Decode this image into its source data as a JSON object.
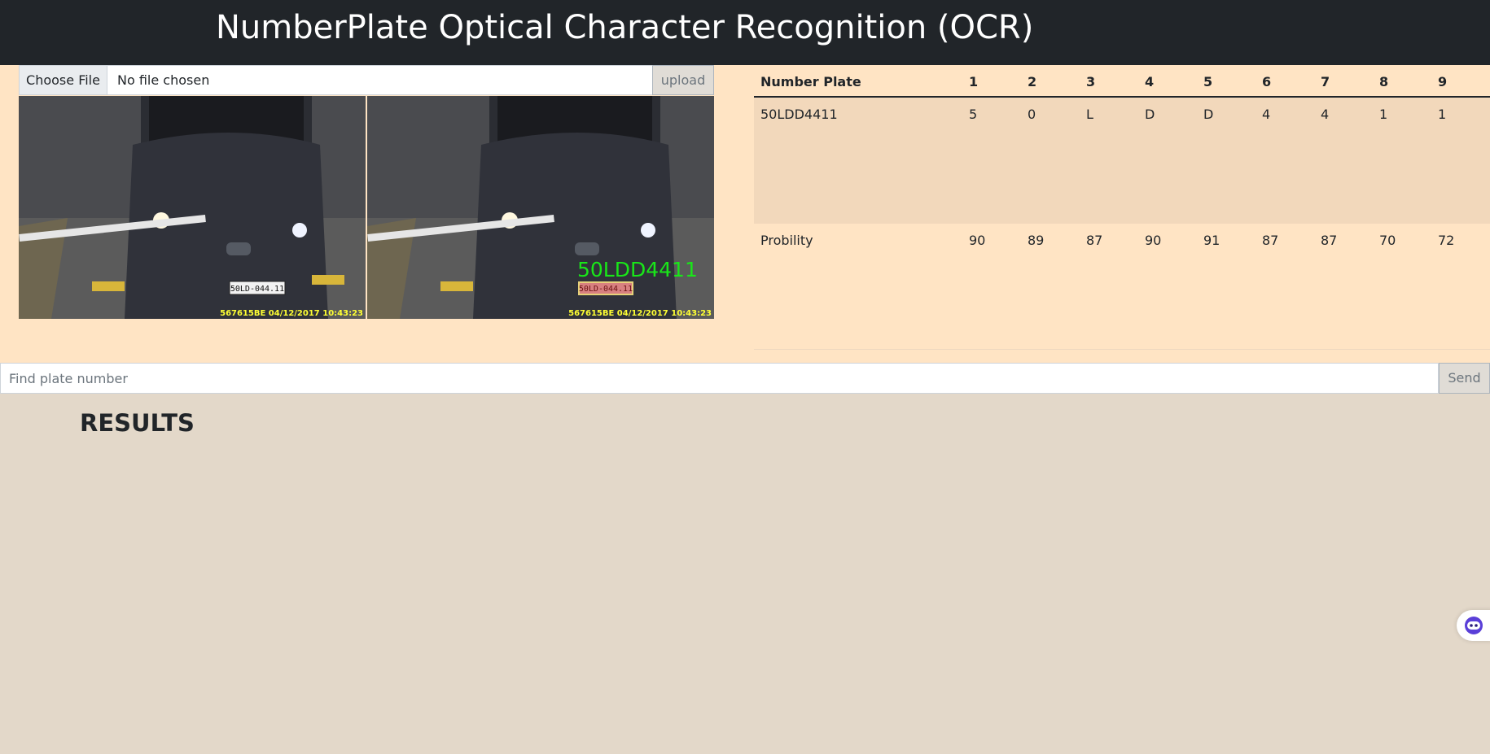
{
  "header": {
    "title": "NumberPlate Optical Character Recognition (OCR)"
  },
  "upload": {
    "choose_label": "Choose File",
    "file_status": "No file chosen",
    "upload_label": "upload"
  },
  "images": {
    "original": {
      "plate_text": "50LD-044.11",
      "overlay_text": "567615BE  04/12/2017 10:43:23"
    },
    "processed": {
      "detected_text": "50LDD4411",
      "plate_text": "50LD-044.11",
      "overlay_text": "567615BE  04/12/2017 10:43:23"
    }
  },
  "table": {
    "headers": [
      "Number Plate",
      "1",
      "2",
      "3",
      "4",
      "5",
      "6",
      "7",
      "8",
      "9"
    ],
    "char_row": [
      "50LDD4411",
      "5",
      "0",
      "L",
      "D",
      "D",
      "4",
      "4",
      "1",
      "1"
    ],
    "prob_row": [
      "Probility",
      "90",
      "89",
      "87",
      "90",
      "91",
      "87",
      "87",
      "70",
      "72"
    ]
  },
  "search": {
    "placeholder": "Find plate number",
    "send_label": "Send"
  },
  "results": {
    "title": "RESULTS"
  },
  "colors": {
    "topbar": "#212529",
    "upper_bg": "#ffe4c4",
    "lower_bg": "#e3d8c9",
    "detected_green": "#19e619"
  }
}
